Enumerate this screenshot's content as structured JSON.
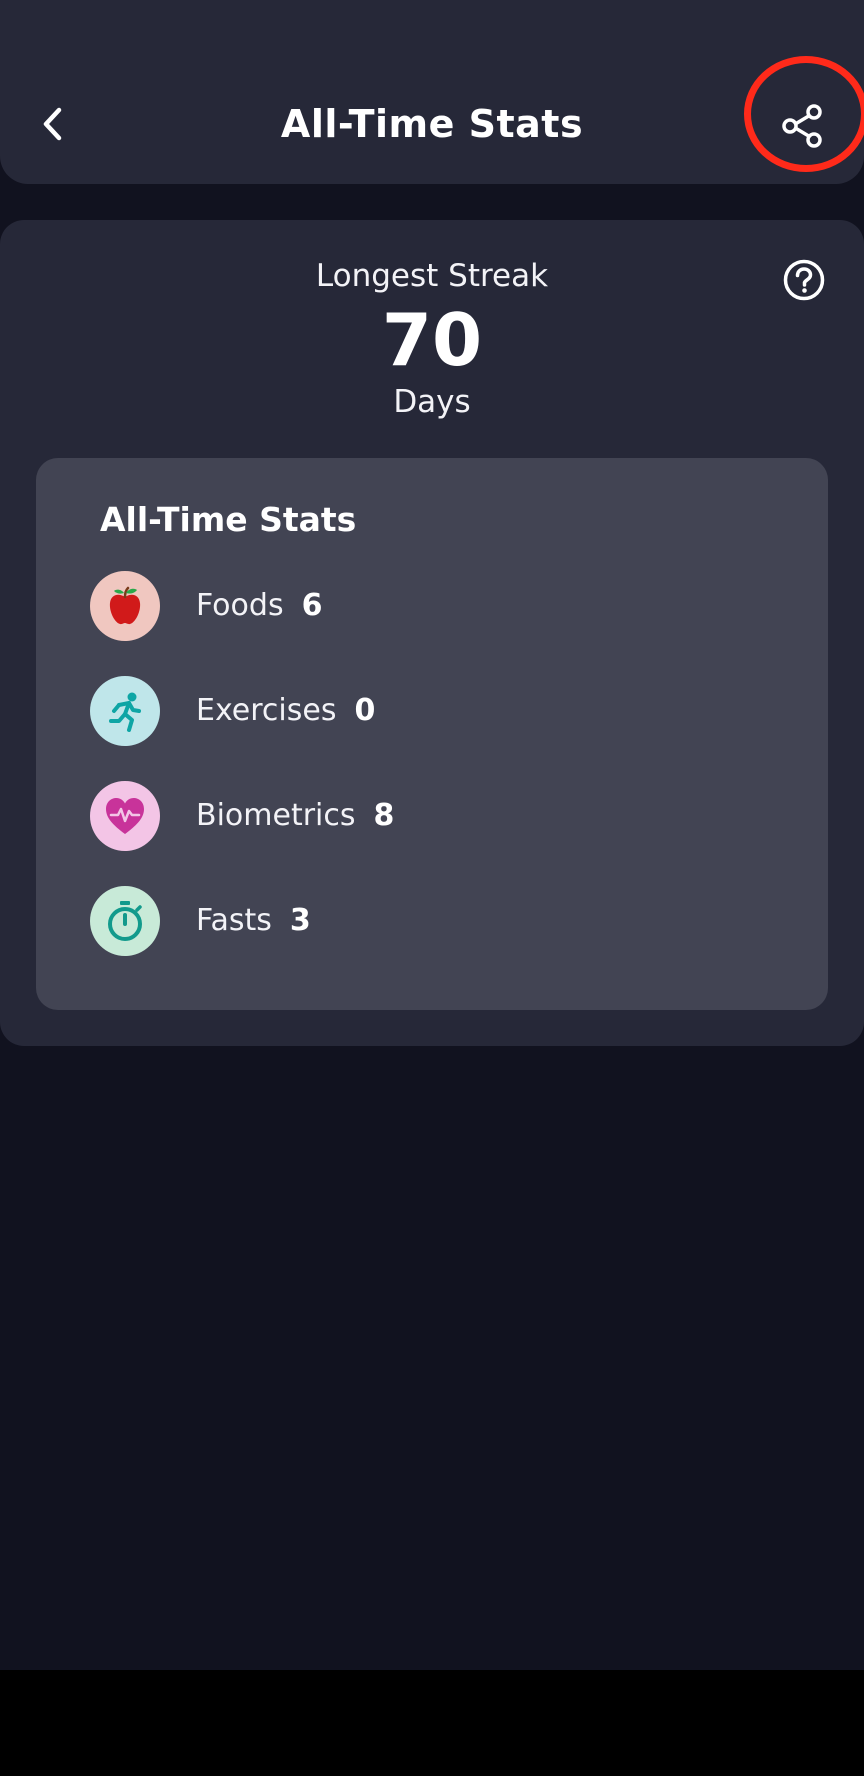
{
  "header": {
    "title": "All-Time Stats",
    "back_icon": "chevron-left-icon",
    "share_icon": "share-icon",
    "highlight_color": "#ff2a1a"
  },
  "streak": {
    "label": "Longest Streak",
    "value": "70",
    "unit": "Days",
    "help_icon": "help-circle-icon"
  },
  "stats": {
    "title": "All-Time Stats",
    "items": [
      {
        "label": "Foods",
        "value": "6",
        "icon": "apple-icon",
        "icon_bg": "#f0c7c0"
      },
      {
        "label": "Exercises",
        "value": "0",
        "icon": "running-icon",
        "icon_bg": "#bfe6ea"
      },
      {
        "label": "Biometrics",
        "value": "8",
        "icon": "heart-pulse-icon",
        "icon_bg": "#f3c5e6"
      },
      {
        "label": "Fasts",
        "value": "3",
        "icon": "stopwatch-icon",
        "icon_bg": "#c8ead8"
      }
    ]
  },
  "colors": {
    "background": "#11121f",
    "card": "#262838",
    "inner_card": "#424453"
  }
}
